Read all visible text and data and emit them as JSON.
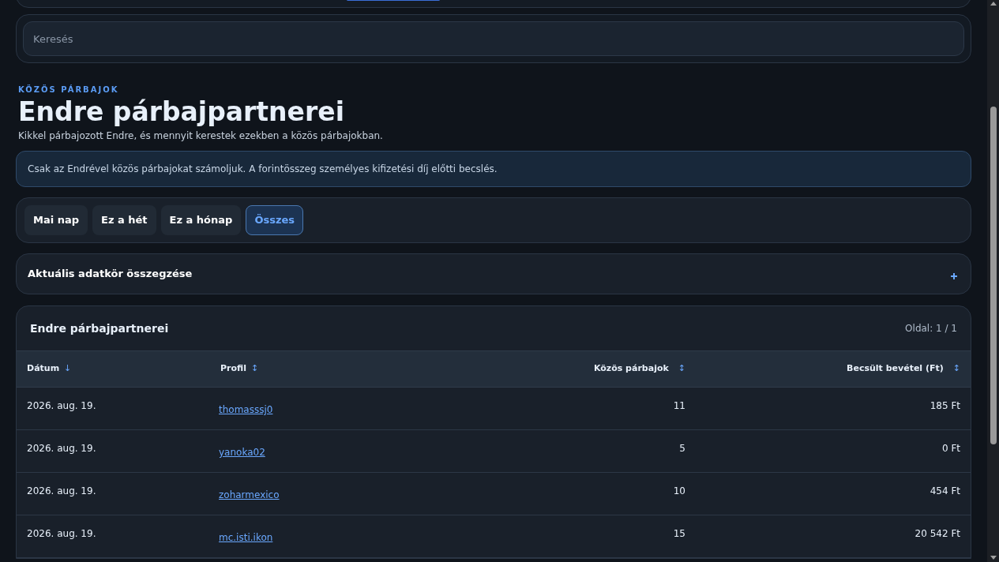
{
  "search": {
    "placeholder": "Keresés"
  },
  "header": {
    "eyebrow": "KÖZÖS PÁRBAJOK",
    "title": "Endre párbajpartnerei",
    "subtitle": "Kikkel párbajozott Endre, és mennyit kerestek ezekben a közös párbajokban."
  },
  "notice": "Csak az Endrével közös párbajokat számoljuk. A forintösszeg személyes kifizetési díj előtti becslés.",
  "period_tabs": [
    {
      "label": "Mai nap",
      "selected": false
    },
    {
      "label": "Ez a hét",
      "selected": false
    },
    {
      "label": "Ez a hónap",
      "selected": false
    },
    {
      "label": "Összes",
      "selected": true
    }
  ],
  "summary": {
    "title": "Aktuális adatkör összegzése",
    "expanded": false
  },
  "table": {
    "title": "Endre párbajpartnerei",
    "page": "Oldal: 1 / 1",
    "columns": [
      {
        "label": "Dátum",
        "sort_icon": "↓",
        "kind": "text"
      },
      {
        "label": "Profil",
        "sort_icon": "↕",
        "kind": "text"
      },
      {
        "label": "Közös párbajok",
        "sort_icon": "↕",
        "kind": "number"
      },
      {
        "label": "Becsült bevétel (Ft)",
        "sort_icon": "↕",
        "kind": "number"
      }
    ],
    "rows": [
      {
        "date": "2026. aug. 19.",
        "profile": "thomasssj0",
        "duels": "11",
        "revenue": "185 Ft"
      },
      {
        "date": "2026. aug. 19.",
        "profile": "yanoka02",
        "duels": "5",
        "revenue": "0 Ft"
      },
      {
        "date": "2026. aug. 19.",
        "profile": "zoharmexico",
        "duels": "10",
        "revenue": "454 Ft"
      },
      {
        "date": "2026. aug. 19.",
        "profile": "mc.isti.ikon",
        "duels": "15",
        "revenue": "20 542 Ft"
      }
    ]
  }
}
